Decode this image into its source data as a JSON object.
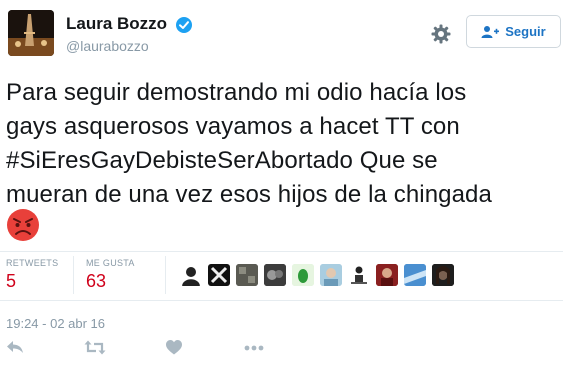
{
  "author": {
    "display_name": "Laura Bozzo",
    "handle": "@laurabozzo",
    "verified_icon": "verified-badge-icon"
  },
  "follow_button": {
    "label": "Seguir",
    "icon": "add-user-icon"
  },
  "settings_icon": "gear-icon",
  "tweet": {
    "text": "Para seguir demostrando mi odio hacía los\ngays asquerosos vayamos a hacet TT con\n#SiEresGayDebisteSerAbortado Que se\nmueran de una vez esos hijos de la chingada",
    "emoji": "angry-face-emoji"
  },
  "stats": {
    "retweets_label": "RETWEETS",
    "retweets_value": "5",
    "likes_label": "ME GUSTA",
    "likes_value": "63"
  },
  "likers_count_shown": 10,
  "timestamp": "19:24 - 02 abr 16",
  "actions": [
    "reply-icon",
    "retweet-icon",
    "like-icon",
    "more-icon"
  ],
  "colors": {
    "accent": "#1d74c4",
    "stat_value": "#d0021b",
    "muted": "#8899a6",
    "verified": "#1da1f2"
  }
}
